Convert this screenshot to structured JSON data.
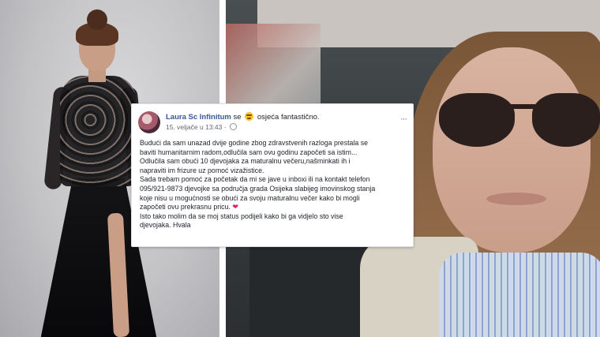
{
  "post": {
    "author": "Laura Sc Infinitum",
    "verb": "se",
    "feeling": "osjeća fantastično.",
    "timestamp": "15. veljače u 13:43",
    "more": "···",
    "body_lines": [
      "Budući da sam unazad dvije godine zbog zdravstvenih razloga prestala se",
      "baviti humanitarnim radom,odlučila sam ovu godinu započeti sa istim...",
      "Odlučila sam obući 10 djevojaka za maturalnu večeru,našminkati ih i",
      "napraviti im frizure uz pomoć vizažistice.",
      "Sada trebam pomoć za početak da mi se jave u inboxi ili na kontakt telefon",
      "095/921-9873 djevojke sa područja grada Osijeka slabijeg imovinskog stanja",
      "koje nisu u mogućnosti se obući za svoju maturalnu večer kako bi mogli",
      "započeti ovu prekrasnu pricu.",
      "Isto tako molim da se moj status podijeli kako bi ga vidjelo sto vise",
      "djevojaka. Hvala"
    ]
  },
  "colors": {
    "author": "#385898",
    "heart": "#e0245e",
    "text": "#1d2129"
  },
  "icons": [
    "feeling-icon",
    "globe-icon",
    "more-icon",
    "heart-icon"
  ]
}
